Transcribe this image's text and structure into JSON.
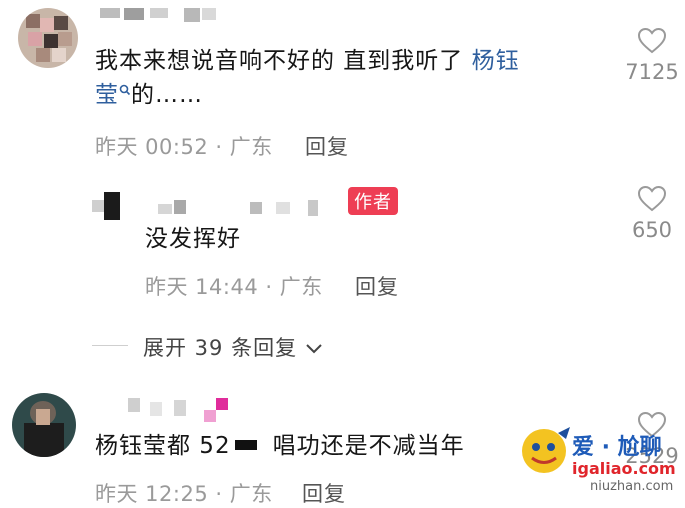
{
  "comments": [
    {
      "text_main": "我本来想说音响不好的 直到我听了",
      "link": "杨钰",
      "line2_link": "莹",
      "line2_rest": "的……",
      "time": "昨天 00:52 · 广东",
      "reply": "回复",
      "likes": "7125"
    },
    {
      "badge": "作者",
      "text": "没发挥好",
      "time": "昨天 14:44 · 广东",
      "reply": "回复",
      "likes": "650"
    },
    {
      "text": "杨钰莹都 52",
      "text_rest": "唱功还是不减当年",
      "time": "昨天 12:25 · 广东",
      "reply": "回复",
      "likes": "2529"
    }
  ],
  "expand": {
    "label": "展开 39 条回复"
  },
  "watermark": {
    "line1": "爱 · 尬聊",
    "line2": "igaliao.com",
    "line3": "niuzhan.com"
  },
  "colors": {
    "link": "#2f5f9e",
    "badge": "#ee3e54",
    "meta": "#9a9a9a"
  },
  "icons": [
    "heart-icon",
    "search-mini-icon",
    "chevron-down-icon"
  ]
}
